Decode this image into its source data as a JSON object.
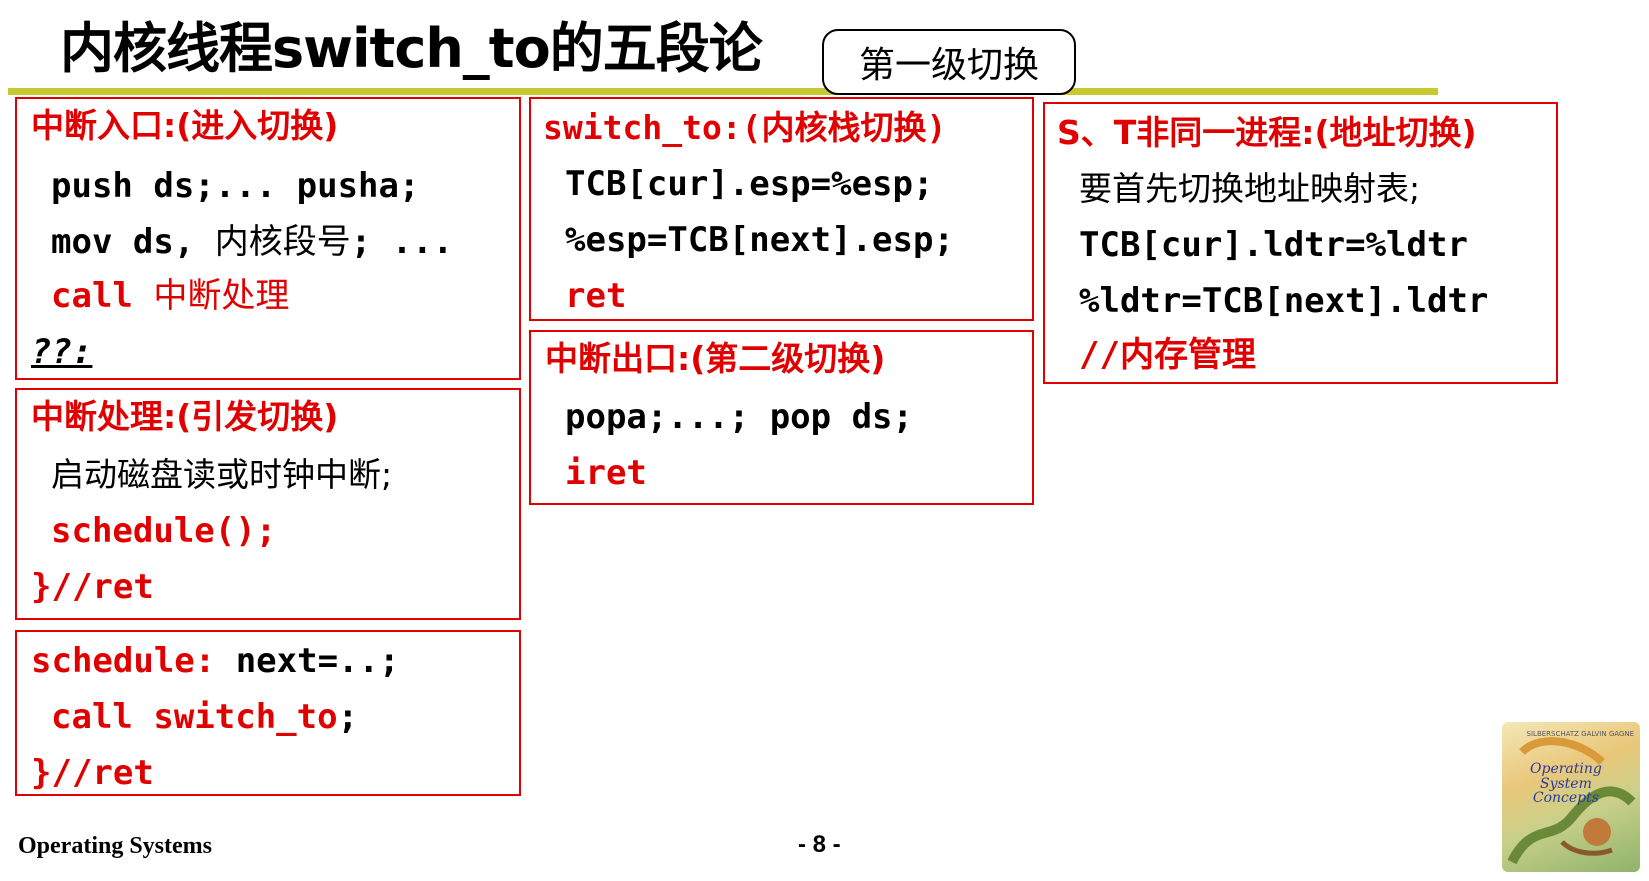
{
  "slide": {
    "title": "内核线程switch_to的五段论",
    "callout": "第一级切换",
    "footer_left": "Operating Systems",
    "page": "- 8 -"
  },
  "box_interrupt_entry": {
    "heading": "中断入口:(进入切换)",
    "line1": "push ds;... pusha;",
    "line2_a": "mov ds, ",
    "line2_b": "内核段号",
    "line2_c": "; ...",
    "line3_a": "call ",
    "line3_b": "中断处理",
    "line4": "??:"
  },
  "box_interrupt_handler": {
    "heading": "中断处理:(引发切换)",
    "line1": "启动磁盘读或时钟中断;",
    "line2": "schedule();",
    "line3": "}//ret"
  },
  "box_schedule": {
    "line1_a": "schedule: ",
    "line1_b": "next=..;",
    "line2_a": "call switch_to",
    "line2_b": ";",
    "line3": "}//ret"
  },
  "box_switch_to": {
    "heading": "switch_to:(内核栈切换)",
    "line1": "TCB[cur].esp=%esp;",
    "line2": "%esp=TCB[next].esp;",
    "line3": "ret"
  },
  "box_interrupt_exit": {
    "heading": "中断出口:(第二级切换)",
    "line1": "popa;...; pop ds;",
    "line2": "iret"
  },
  "box_address_switch": {
    "heading": "S、T非同一进程:(地址切换)",
    "line1": "要首先切换地址映射表;",
    "line2": "TCB[cur].ldtr=%ldtr",
    "line3": "%ldtr=TCB[next].ldtr",
    "line4": "//内存管理"
  },
  "book_cover": {
    "title_line1": "Operating",
    "title_line2": "System",
    "title_line3": "Concepts",
    "authors": "SILBERSCHATZ GALVIN GAGNE"
  },
  "colors": {
    "accent_red": "#e00000",
    "rule_olive": "#c8c830"
  }
}
